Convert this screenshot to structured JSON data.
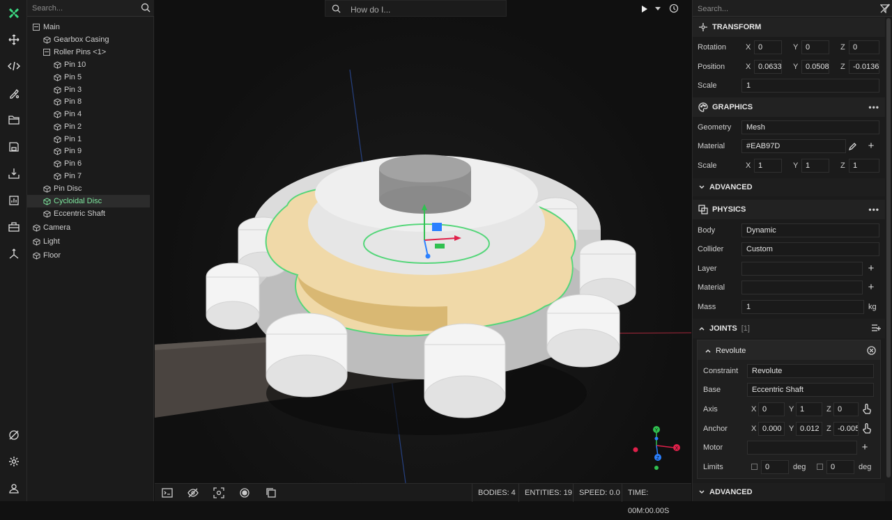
{
  "toolbar": {
    "icons": [
      "app-logo-icon",
      "move-icon",
      "code-icon",
      "paint-icon",
      "folder-icon",
      "save-icon",
      "import-icon",
      "chart-icon",
      "toolbox-icon",
      "axes-icon",
      "no-physics-icon",
      "settings-icon",
      "user-icon"
    ],
    "accent": "#3ddc84"
  },
  "outliner": {
    "search_placeholder": "Search...",
    "items": [
      {
        "label": "Main",
        "type": "group"
      },
      {
        "label": "Gearbox Casing",
        "type": "entity"
      },
      {
        "label": "Roller Pins <1>",
        "type": "group"
      },
      {
        "label": "Pin 10",
        "type": "entity"
      },
      {
        "label": "Pin 5",
        "type": "entity"
      },
      {
        "label": "Pin 3",
        "type": "entity"
      },
      {
        "label": "Pin 8",
        "type": "entity"
      },
      {
        "label": "Pin 4",
        "type": "entity"
      },
      {
        "label": "Pin 2",
        "type": "entity"
      },
      {
        "label": "Pin 1",
        "type": "entity"
      },
      {
        "label": "Pin 9",
        "type": "entity"
      },
      {
        "label": "Pin 6",
        "type": "entity"
      },
      {
        "label": "Pin 7",
        "type": "entity"
      },
      {
        "label": "Pin Disc",
        "type": "entity"
      },
      {
        "label": "Cycloidal Disc",
        "type": "entity",
        "selected": true
      },
      {
        "label": "Eccentric Shaft",
        "type": "entity"
      },
      {
        "label": "Camera",
        "type": "entity"
      },
      {
        "label": "Light",
        "type": "entity"
      },
      {
        "label": "Floor",
        "type": "entity"
      }
    ]
  },
  "viewport": {
    "search_placeholder": "How do I..."
  },
  "status": {
    "bodies": "BODIES: 4",
    "entities": "ENTITIES: 19",
    "speed": "SPEED: 0.0",
    "time": "TIME: 00M:00.00S"
  },
  "inspector": {
    "search_placeholder": "Search...",
    "transform": {
      "title": "TRANSFORM",
      "rotation": {
        "label": "Rotation",
        "x": "0",
        "y": "0",
        "z": "0"
      },
      "position": {
        "label": "Position",
        "x": "0.0633",
        "y": "0.0508",
        "z": "-0.0136"
      },
      "scale": {
        "label": "Scale",
        "value": "1"
      }
    },
    "graphics": {
      "title": "GRAPHICS",
      "geometry": {
        "label": "Geometry",
        "value": "Mesh"
      },
      "material": {
        "label": "Material",
        "value": "#EAB97D"
      },
      "scale": {
        "label": "Scale",
        "x": "1",
        "y": "1",
        "z": "1"
      },
      "advanced": "ADVANCED"
    },
    "physics": {
      "title": "PHYSICS",
      "body": {
        "label": "Body",
        "value": "Dynamic"
      },
      "collider": {
        "label": "Collider",
        "value": "Custom"
      },
      "layer": {
        "label": "Layer",
        "value": ""
      },
      "material": {
        "label": "Material",
        "value": ""
      },
      "mass": {
        "label": "Mass",
        "value": "1",
        "unit": "kg"
      }
    },
    "joints": {
      "title": "JOINTS",
      "count": "[1]",
      "joint": {
        "name": "Revolute",
        "constraint": {
          "label": "Constraint",
          "value": "Revolute"
        },
        "base": {
          "label": "Base",
          "value": "Eccentric Shaft"
        },
        "axis": {
          "label": "Axis",
          "x": "0",
          "y": "1",
          "z": "0"
        },
        "anchor": {
          "label": "Anchor",
          "x": "0.000",
          "y": "0.012",
          "z": "-0.005"
        },
        "motor": {
          "label": "Motor",
          "value": ""
        },
        "limits": {
          "label": "Limits",
          "min": "0",
          "max": "0",
          "unit": "deg"
        }
      },
      "advanced": "ADVANCED"
    }
  },
  "axis_labels": {
    "x": "X",
    "y": "Y",
    "z": "Z"
  }
}
